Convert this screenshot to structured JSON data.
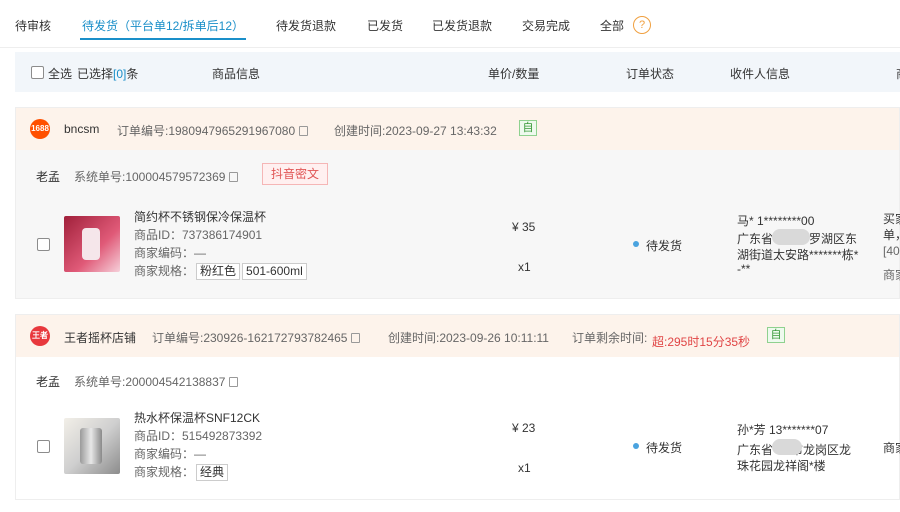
{
  "tabs": [
    {
      "label": "待审核"
    },
    {
      "label": "待发货（平台单12/拆单后12）"
    },
    {
      "label": "待发货退款"
    },
    {
      "label": "已发货"
    },
    {
      "label": "已发货退款"
    },
    {
      "label": "交易完成"
    },
    {
      "label": "全部"
    }
  ],
  "help_icon": "?",
  "table_header": {
    "select_all": "全选",
    "selected_prefix": "已选择",
    "selected_count": "[0]",
    "selected_suffix": "条",
    "goods": "商品信息",
    "price_qty": "单价/数量",
    "status": "订单状态",
    "receiver": "收件人信息",
    "more": "商"
  },
  "orders": [
    {
      "shop_logo": "1688",
      "shop_name": "bncsm",
      "order_no": "订单编号:1980947965291967080",
      "created": "创建时间:2023-09-27 13:43:32",
      "remaining_label": "",
      "remaining_value": "",
      "auto_tag": "自",
      "operator": "老孟",
      "system_no": "系统单号:100004579572369",
      "platform_tag": "抖音密文",
      "item": {
        "name": "简约杯不锈钢保冷保温杯",
        "goods_id": "商品ID：737386174901",
        "merchant_code": "商家编码：—",
        "spec_label": "商家规格：",
        "specs": [
          "粉红色",
          "501-600ml"
        ],
        "price": "¥ 35",
        "qty": "x1",
        "status": "待发货",
        "receiver_name": "马* 1********00",
        "receiver_addr1_a": "广东省",
        "receiver_addr1_b": "罗湖区东",
        "receiver_addr2": "湖街道太安路*******栋*",
        "receiver_addr3": "-**",
        "extra1": "买家",
        "extra2": "单，",
        "extra3": "[40",
        "extra4": "商家"
      },
      "colors": {
        "logo": "#ff5000",
        "thumb": "#c8384e"
      }
    },
    {
      "shop_logo": "王者",
      "shop_name": "王者摇杯店铺",
      "order_no": "订单编号:230926-162172793782465",
      "created": "创建时间:2023-09-26 10:11:11",
      "remaining_label": "订单剩余时间:",
      "remaining_value": "超:295时15分35秒",
      "auto_tag": "自",
      "operator": "老孟",
      "system_no": "系统单号:200004542138837",
      "platform_tag": "",
      "item": {
        "name": "热水杯保温杯SNF12CK",
        "goods_id": "商品ID：515492873392",
        "merchant_code": "商家编码：—",
        "spec_label": "商家规格：",
        "specs": [
          "经典"
        ],
        "price": "¥ 23",
        "qty": "x1",
        "status": "待发货",
        "receiver_name": "孙*芳 13*******07",
        "receiver_addr1_a": "广东省",
        "receiver_addr1_b": "市龙岗区龙",
        "receiver_addr2": "珠花园龙祥阁*楼",
        "receiver_addr3": "",
        "extra1": "商家",
        "extra2": "",
        "extra3": "",
        "extra4": ""
      },
      "colors": {
        "logo": "#e8383d",
        "thumb": "#b9b9b9"
      }
    }
  ],
  "colors": {
    "accent": "#1a8fc9",
    "warning": "#e04545",
    "header_bg": "#fdf3eb"
  }
}
